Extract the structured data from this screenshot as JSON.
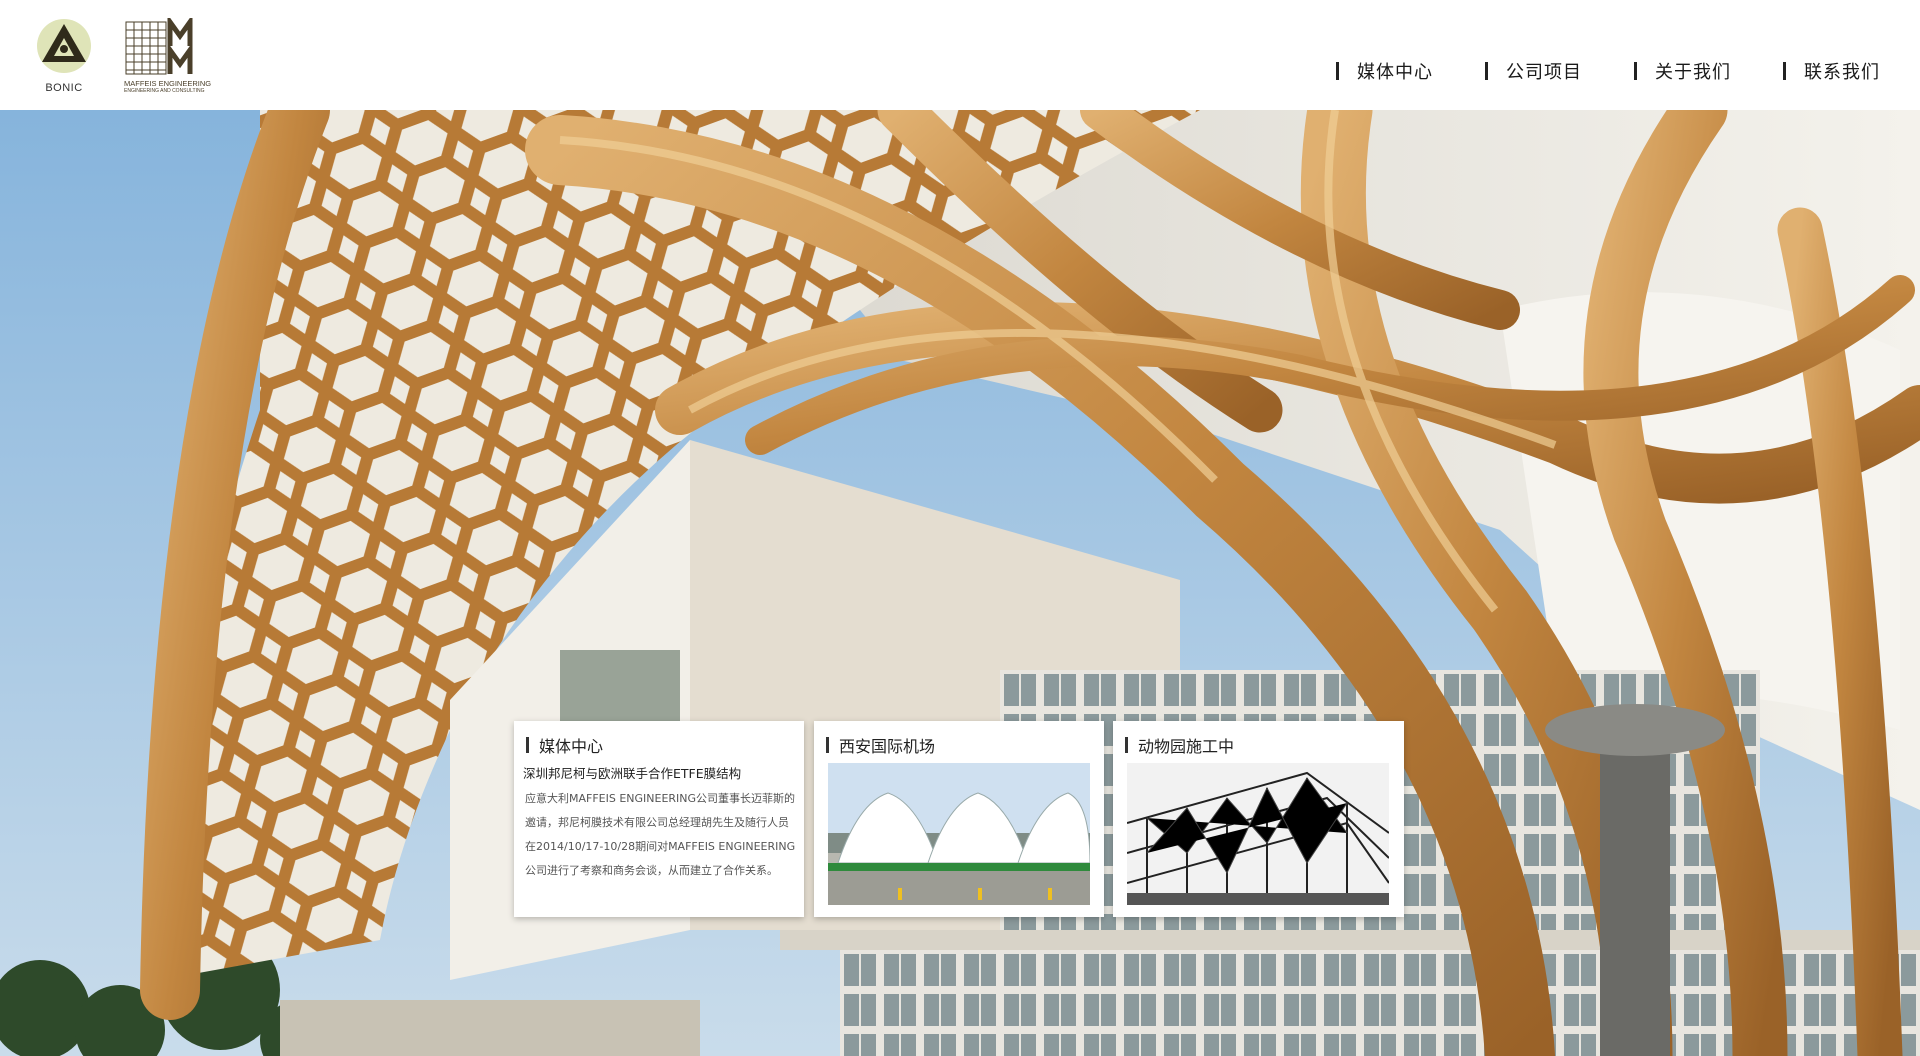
{
  "header": {
    "logo_bonic_text": "BONIC",
    "logo_maffeis_text": "MAFFEIS ENGINEERING",
    "logo_maffeis_sub": "ENGINEERING AND CONSULTING",
    "nav": [
      {
        "label": "媒体中心"
      },
      {
        "label": "公司项目"
      },
      {
        "label": "关于我们"
      },
      {
        "label": "联系我们"
      }
    ]
  },
  "cards": {
    "news": {
      "title": "媒体中心",
      "headline": "深圳邦尼柯与欧洲联手合作ETFE膜结构",
      "body": "应意大利MAFFEIS ENGINEERING公司董事长迈菲斯的邀请，邦尼柯膜技术有限公司总经理胡先生及随行人员在2014/10/17-10/28期间对MAFFEIS ENGINEERING公司进行了考察和商务会谈，从而建立了合作关系。"
    },
    "project1": {
      "title": "西安国际机场"
    },
    "project2": {
      "title": "动物园施工中"
    }
  },
  "colors": {
    "wood": "#c8924a",
    "wood_dark": "#8a5a24",
    "sky": "#a9c9e3",
    "membrane": "#e8e6e0",
    "nav_text": "#1a1a1a"
  },
  "icons": {
    "bonic_logo": "triangle-circle-logo",
    "maffeis_logo": "grid-mm-logo"
  }
}
